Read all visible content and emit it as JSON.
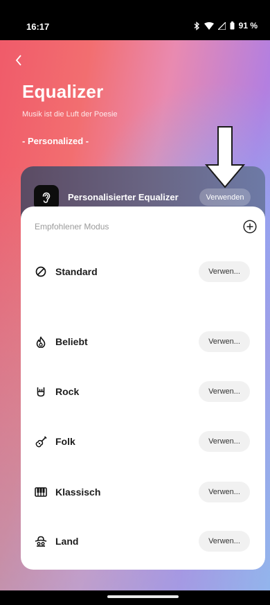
{
  "status": {
    "time": "16:17",
    "battery": "91 %"
  },
  "header": {
    "title": "Equalizer",
    "subtitle": "Musik ist die Luft der Poesie",
    "mode_label": "- Personalized -"
  },
  "personal": {
    "label": "Personalisierter Equalizer",
    "apply_label": "Verwenden"
  },
  "recommended": {
    "header": "Empfohlener Modus",
    "items": [
      {
        "name": "Standard",
        "icon": "circle-slash-icon",
        "apply_label": "Verwen..."
      },
      {
        "name": "Beliebt",
        "icon": "flame-icon",
        "apply_label": "Verwen..."
      },
      {
        "name": "Rock",
        "icon": "rock-hand-icon",
        "apply_label": "Verwen..."
      },
      {
        "name": "Folk",
        "icon": "guitar-icon",
        "apply_label": "Verwen..."
      },
      {
        "name": "Klassisch",
        "icon": "piano-icon",
        "apply_label": "Verwen..."
      },
      {
        "name": "Land",
        "icon": "cowboy-icon",
        "apply_label": "Verwen..."
      }
    ]
  },
  "colors": {
    "accent": "#f05b6a",
    "sheet": "#ffffff",
    "button_bg": "#f1f1f1"
  }
}
